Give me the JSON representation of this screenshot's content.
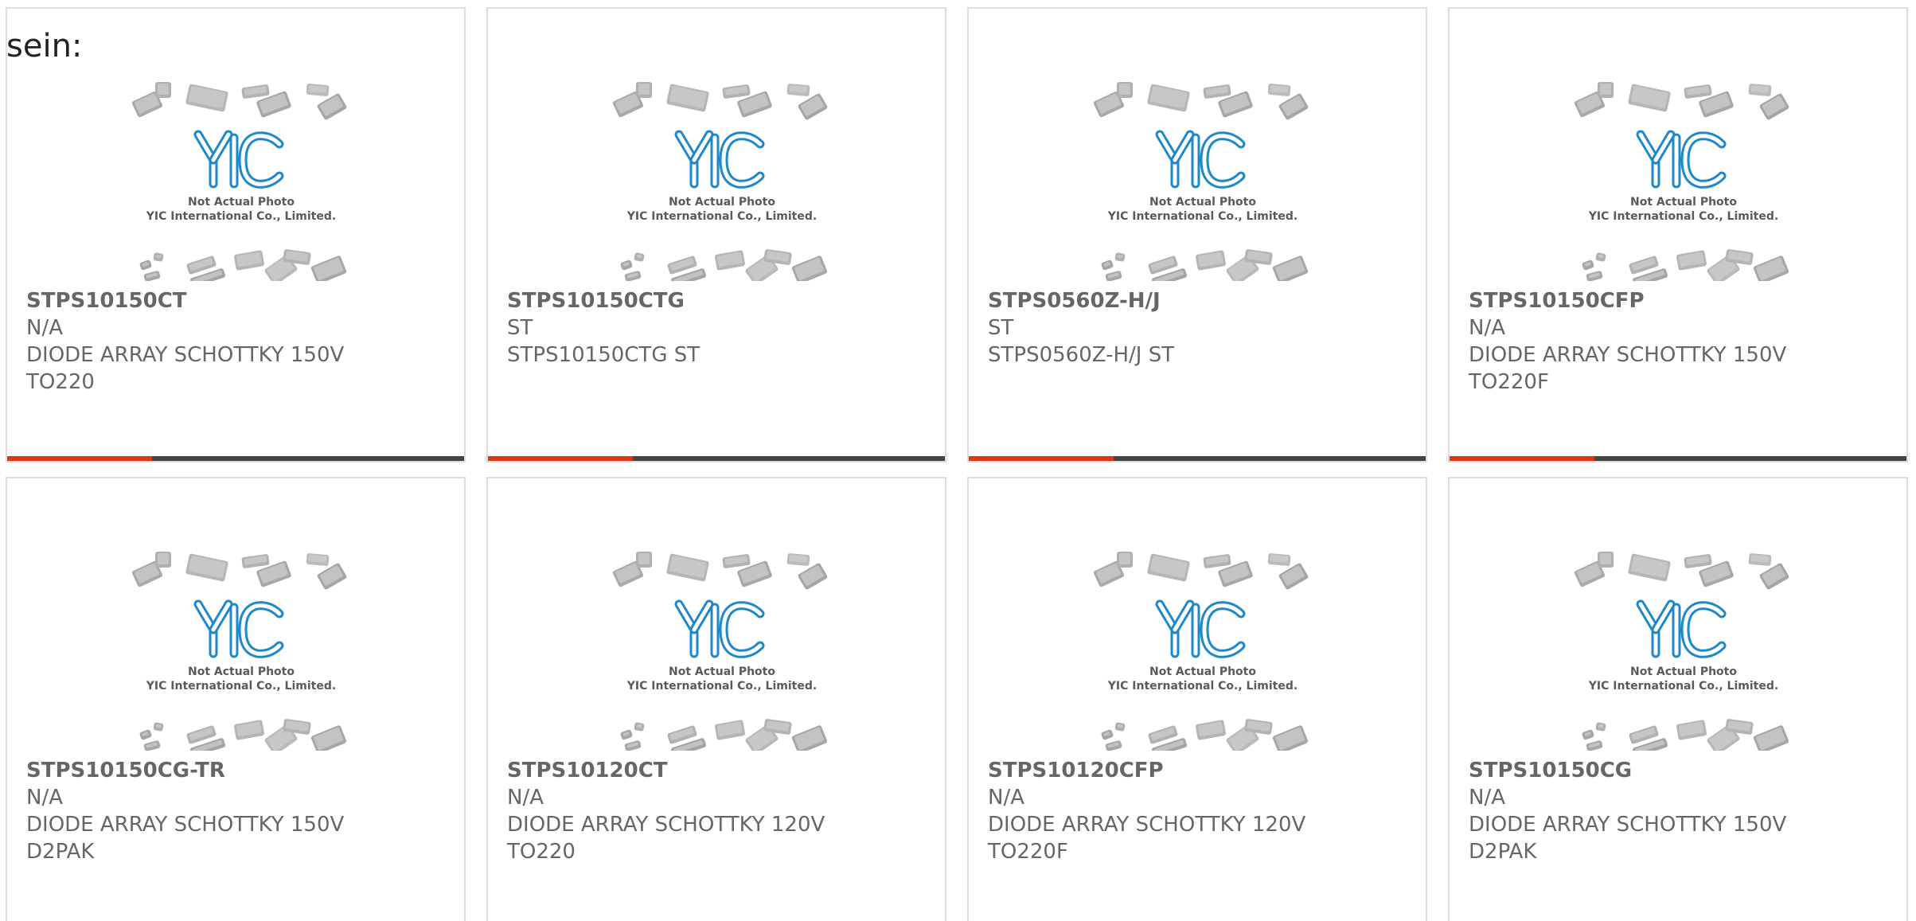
{
  "intro_text": "sein:",
  "placeholder": {
    "logo": "YIC",
    "line1": "Not Actual Photo",
    "line2": "YIC International Co., Limited."
  },
  "colors": {
    "accent": "#d93a16",
    "bar": "#444444",
    "logo_blue": "#1e88c8",
    "text": "#666666",
    "border": "#dddddd"
  },
  "products": [
    {
      "part": "STPS10150CT",
      "manufacturer": "N/A",
      "description": "DIODE ARRAY SCHOTTKY 150V",
      "package": "TO220"
    },
    {
      "part": "STPS10150CTG",
      "manufacturer": "ST",
      "description": "STPS10150CTG ST",
      "package": ""
    },
    {
      "part": "STPS0560Z-H/J",
      "manufacturer": "ST",
      "description": "STPS0560Z-H/J ST",
      "package": ""
    },
    {
      "part": "STPS10150CFP",
      "manufacturer": "N/A",
      "description": "DIODE ARRAY SCHOTTKY 150V",
      "package": "TO220F"
    },
    {
      "part": "STPS10150CG-TR",
      "manufacturer": "N/A",
      "description": "DIODE ARRAY SCHOTTKY 150V",
      "package": "D2PAK"
    },
    {
      "part": "STPS10120CT",
      "manufacturer": "N/A",
      "description": "DIODE ARRAY SCHOTTKY 120V",
      "package": "TO220"
    },
    {
      "part": "STPS10120CFP",
      "manufacturer": "N/A",
      "description": "DIODE ARRAY SCHOTTKY 120V",
      "package": "TO220F"
    },
    {
      "part": "STPS10150CG",
      "manufacturer": "N/A",
      "description": "DIODE ARRAY SCHOTTKY 150V",
      "package": "D2PAK"
    }
  ]
}
